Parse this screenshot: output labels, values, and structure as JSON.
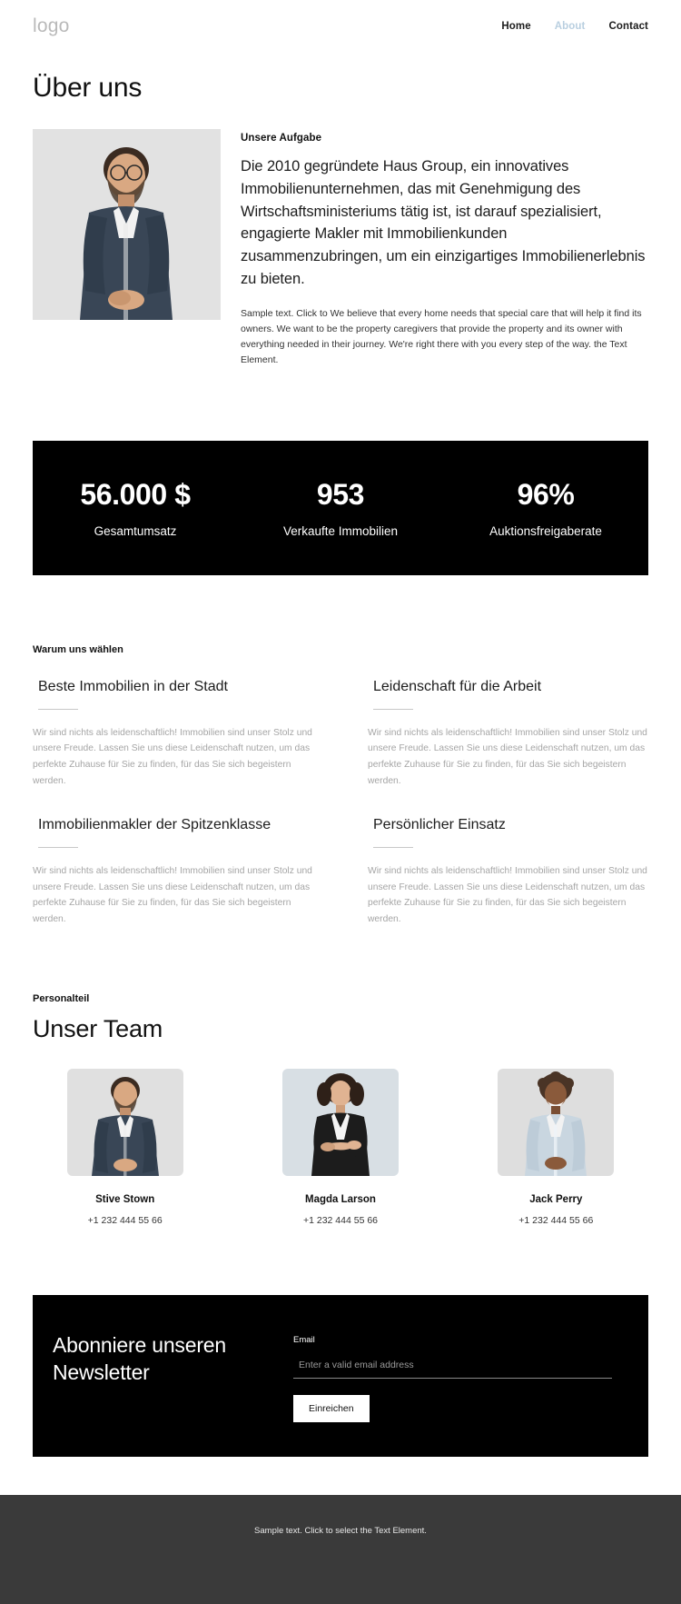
{
  "header": {
    "logo": "logo",
    "nav": [
      {
        "label": "Home",
        "active": false
      },
      {
        "label": "About",
        "active": true
      },
      {
        "label": "Contact",
        "active": false
      }
    ]
  },
  "page_title": "Über uns",
  "about": {
    "kicker": "Unsere Aufgabe",
    "lead": "Die 2010 gegründete Haus Group, ein innovatives Immobilienunternehmen, das mit Genehmigung des Wirtschaftsministeriums tätig ist, ist darauf spezialisiert, engagierte Makler mit Immobilienkunden zusammenzubringen, um ein einzigartiges Immobilienerlebnis zu bieten.",
    "small_copy": "Sample text. Click to We believe that every home needs that special care that will help it find its owners. We want to be the property caregivers that provide the property and its owner with everything needed in their journey. We're right there with you every step of the way. the Text Element.",
    "photo_alt": "portrait-man-blue-shirt"
  },
  "stats": [
    {
      "value": "56.000 $",
      "label": "Gesamtumsatz"
    },
    {
      "value": "953",
      "label": "Verkaufte Immobilien"
    },
    {
      "value": "96%",
      "label": "Auktionsfreigaberate"
    }
  ],
  "features": {
    "kicker": "Warum uns wählen",
    "items": [
      {
        "title": "Beste Immobilien in der Stadt",
        "body": "Wir sind nichts als leidenschaftlich! Immobilien sind unser Stolz und unsere Freude. Lassen Sie uns diese Leidenschaft nutzen, um das perfekte Zuhause für Sie zu finden, für das Sie sich begeistern werden."
      },
      {
        "title": "Leidenschaft für die Arbeit",
        "body": "Wir sind nichts als leidenschaftlich! Immobilien sind unser Stolz und unsere Freude. Lassen Sie uns diese Leidenschaft nutzen, um das perfekte Zuhause für Sie zu finden, für das Sie sich begeistern werden."
      },
      {
        "title": "Immobilienmakler der Spitzenklasse",
        "body": "Wir sind nichts als leidenschaftlich! Immobilien sind unser Stolz und unsere Freude. Lassen Sie uns diese Leidenschaft nutzen, um das perfekte Zuhause für Sie zu finden, für das Sie sich begeistern werden."
      },
      {
        "title": "Persönlicher Einsatz",
        "body": "Wir sind nichts als leidenschaftlich! Immobilien sind unser Stolz und unsere Freude. Lassen Sie uns diese Leidenschaft nutzen, um das perfekte Zuhause für Sie zu finden, für das Sie sich begeistern werden."
      }
    ]
  },
  "team": {
    "kicker": "Personalteil",
    "title": "Unser Team",
    "members": [
      {
        "name": "Stive Stown",
        "phone": "+1 232 444 55 66",
        "photo_alt": "portrait-man-denim-shirt"
      },
      {
        "name": "Magda Larson",
        "phone": "+1 232 444 55 66",
        "photo_alt": "portrait-woman-black-vest"
      },
      {
        "name": "Jack Perry",
        "phone": "+1 232 444 55 66",
        "photo_alt": "portrait-man-light-blue-shirt"
      }
    ]
  },
  "newsletter": {
    "title": "Abonniere unseren Newsletter",
    "email_label": "Email",
    "email_value": "",
    "email_placeholder": "Enter a valid email address",
    "submit_label": "Einreichen"
  },
  "footer": {
    "text": "Sample text. Click to select the Text Element."
  },
  "colors": {
    "accent_nav_active": "#b9cfe0",
    "dark_panel": "#000000",
    "footer_bg": "#3a3a3a",
    "muted_text": "#a5a5a5",
    "photo_bg": "#e2e2e2"
  }
}
